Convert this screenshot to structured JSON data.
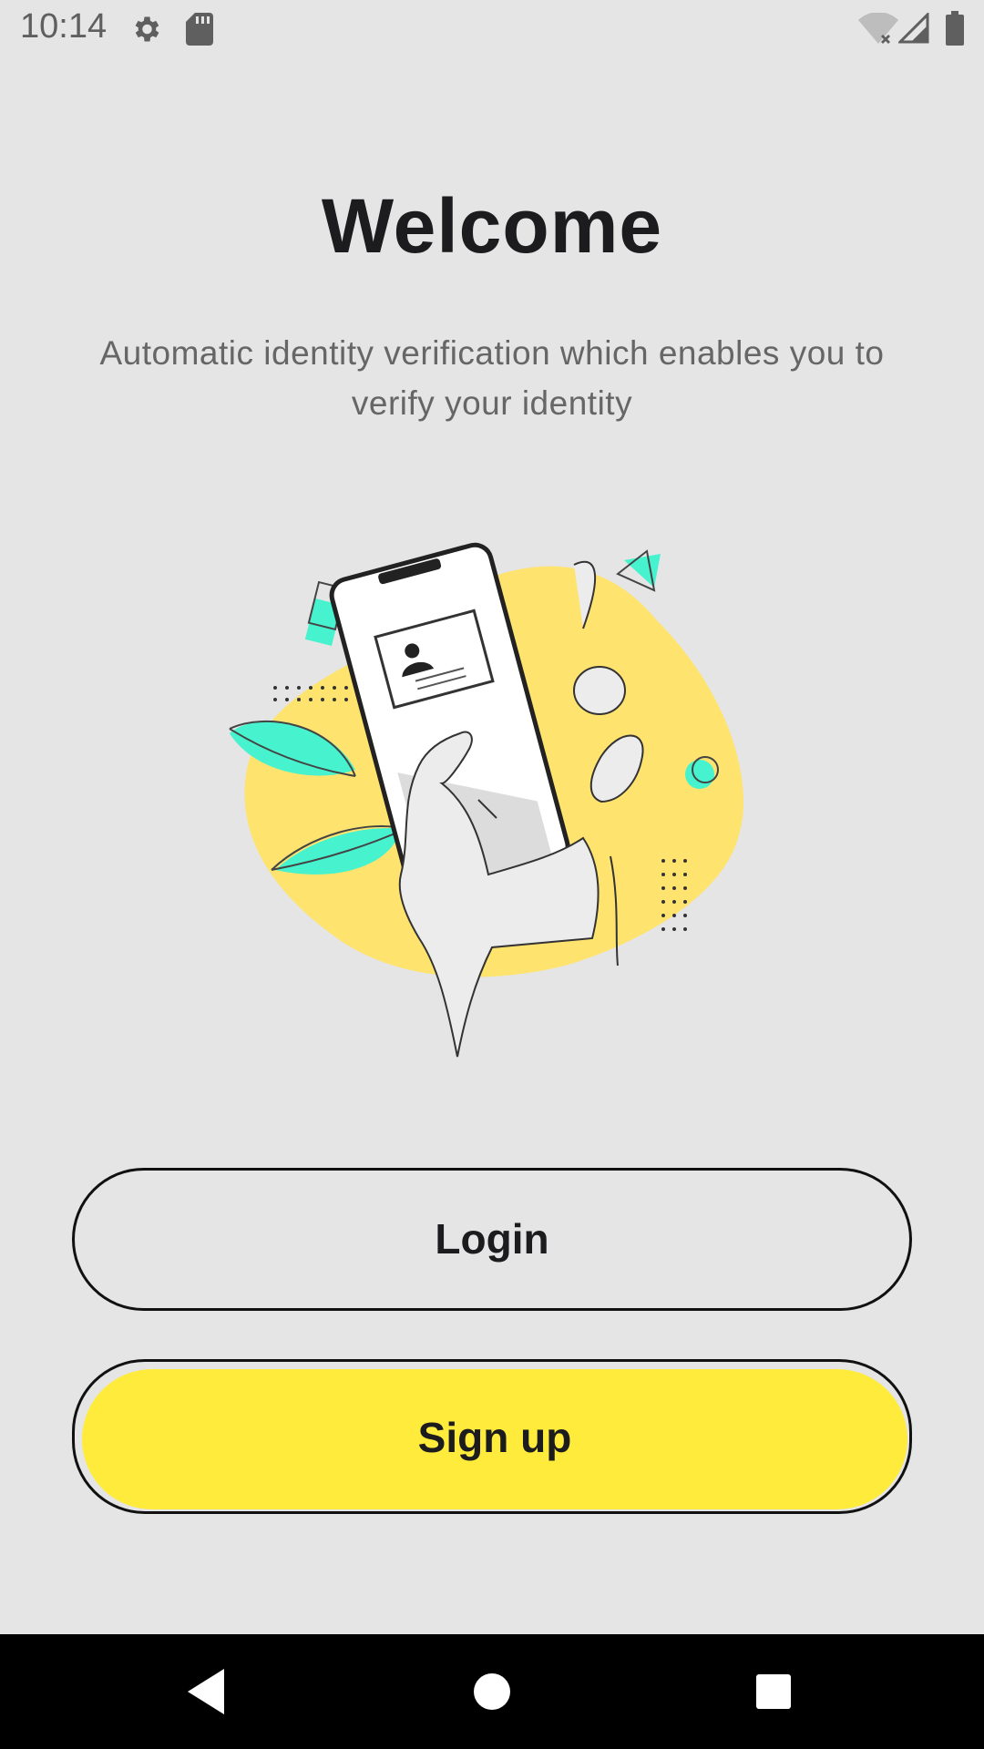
{
  "status_bar": {
    "time": "10:14",
    "icons_left": [
      "gear-icon",
      "sd-card-icon"
    ],
    "icons_right": [
      "wifi-off-icon",
      "cell-signal-icon",
      "battery-icon"
    ]
  },
  "welcome": {
    "title": "Welcome",
    "subtitle": "Automatic identity verification which enables you to verify your identity"
  },
  "buttons": {
    "login_label": "Login",
    "signup_label": "Sign up"
  },
  "nav_bar": {
    "icons": [
      "back-icon",
      "home-icon",
      "recents-icon"
    ]
  },
  "colors": {
    "accent_yellow": "#ffeb3b",
    "blob_yellow": "#fee36e",
    "illustration_teal": "#47f2cf",
    "background": "#e5e5e5"
  }
}
